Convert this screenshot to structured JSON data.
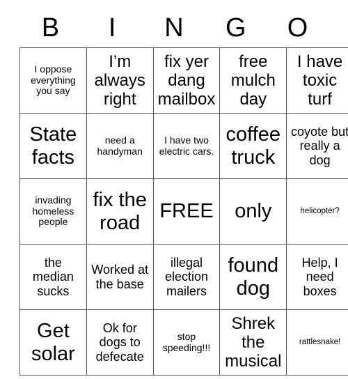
{
  "card": {
    "header_letters": [
      "B",
      "I",
      "N",
      "G",
      "O"
    ],
    "rows": [
      [
        {
          "text": "I oppose everything you say",
          "size": "sz-s"
        },
        {
          "text": "I’m always right",
          "size": "sz-l"
        },
        {
          "text": "fix yer dang mailbox",
          "size": "sz-l"
        },
        {
          "text": "free mulch day",
          "size": "sz-l"
        },
        {
          "text": "I have toxic turf",
          "size": "sz-l"
        }
      ],
      [
        {
          "text": "State facts",
          "size": "sz-xl"
        },
        {
          "text": "need a handyman",
          "size": "sz-s"
        },
        {
          "text": "I have two electric cars.",
          "size": "sz-s"
        },
        {
          "text": "coffee truck",
          "size": "sz-xl"
        },
        {
          "text": "coyote but really a dog",
          "size": "sz-m"
        }
      ],
      [
        {
          "text": "invading homeless people",
          "size": "sz-s"
        },
        {
          "text": "fix the road",
          "size": "sz-xl"
        },
        {
          "text": "FREE",
          "size": "sz-xl"
        },
        {
          "text": "only",
          "size": "sz-xl"
        },
        {
          "text": "helicopter?",
          "size": "sz-xs"
        }
      ],
      [
        {
          "text": "the median sucks",
          "size": "sz-m"
        },
        {
          "text": "Worked at the base",
          "size": "sz-m"
        },
        {
          "text": "illegal election mailers",
          "size": "sz-m"
        },
        {
          "text": "found dog",
          "size": "sz-xl"
        },
        {
          "text": "Help, I need boxes",
          "size": "sz-m"
        }
      ],
      [
        {
          "text": "Get solar",
          "size": "sz-xl"
        },
        {
          "text": "Ok for dogs to defecate",
          "size": "sz-m"
        },
        {
          "text": "stop speeding!!!",
          "size": "sz-s"
        },
        {
          "text": "Shrek the musical",
          "size": "sz-l"
        },
        {
          "text": "rattlesnake!",
          "size": "sz-xs"
        }
      ]
    ]
  },
  "colors": {
    "background": "#ffffff",
    "text": "#000000",
    "grid_line": "#555555"
  }
}
